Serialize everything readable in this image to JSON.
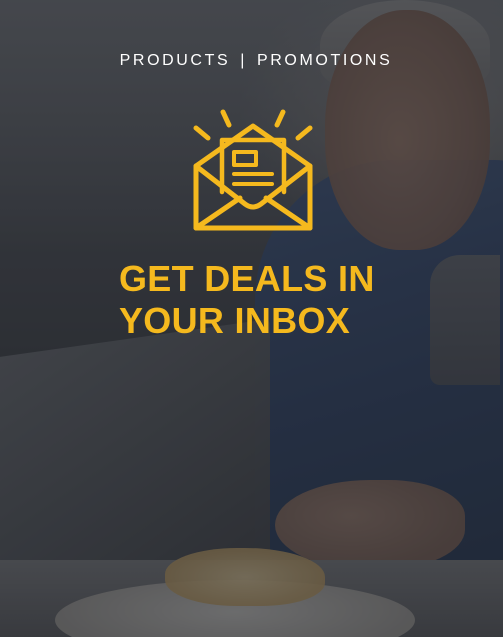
{
  "nav": {
    "products": "PRODUCTS",
    "separator": "|",
    "promotions": "PROMOTIONS"
  },
  "hero": {
    "icon": "open-envelope-icon",
    "headline_line1": "GET DEALS IN",
    "headline_line2": "YOUR INBOX"
  },
  "colors": {
    "accent": "#f5b91e",
    "nav_text": "#ffffff",
    "overlay": "#1c1e23"
  }
}
